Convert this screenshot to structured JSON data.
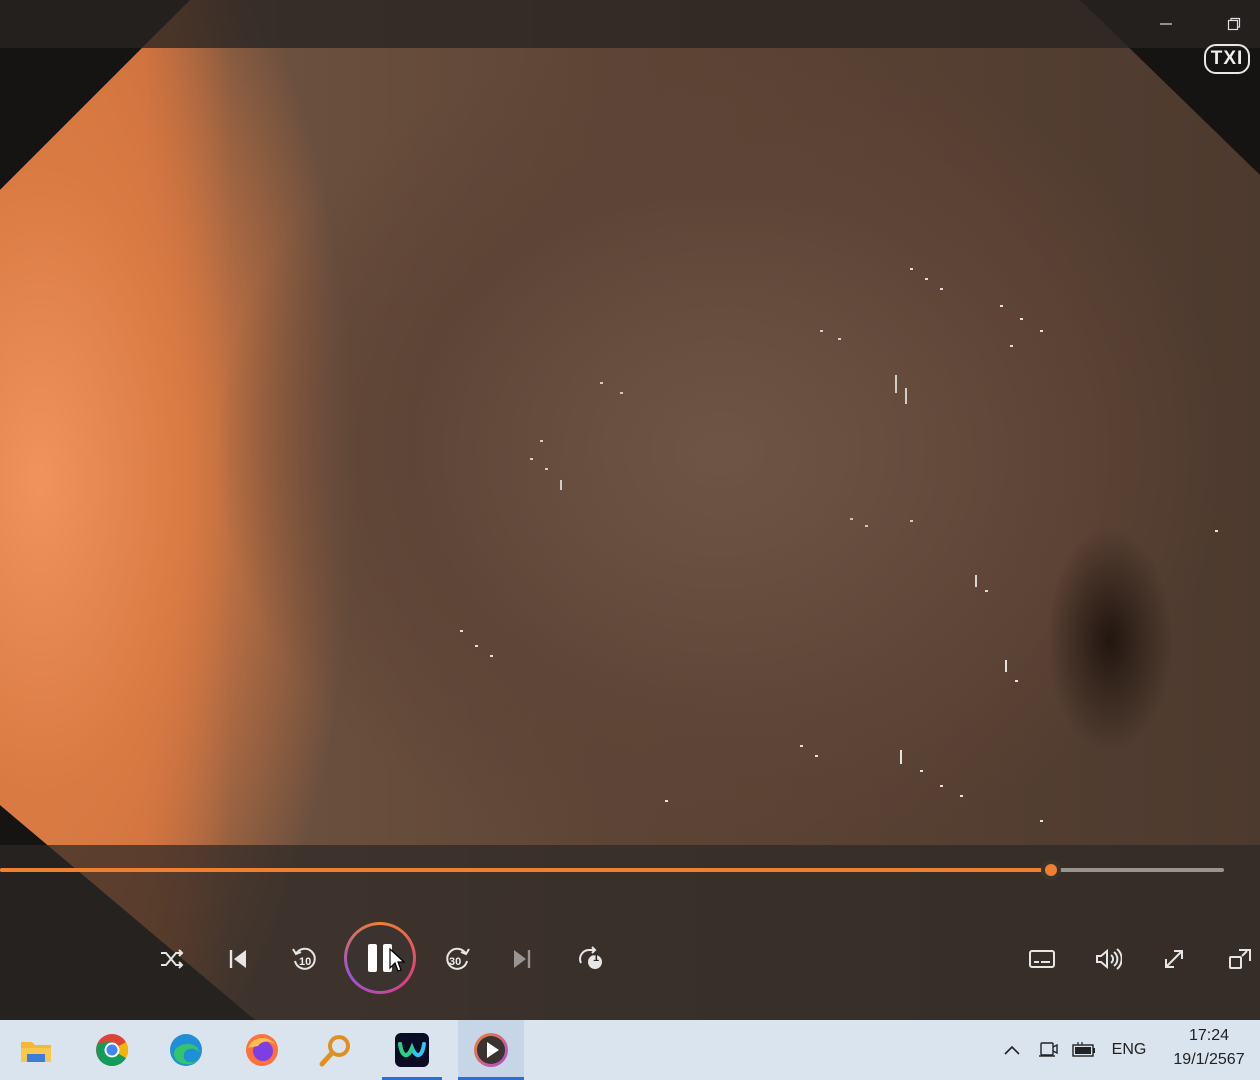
{
  "window": {
    "minimize_icon": "minimize-icon",
    "restore_icon": "restore-icon"
  },
  "overlay": {
    "badge": "TXI"
  },
  "player": {
    "progress": 0.859,
    "accent_color": "#f08030",
    "controls": {
      "shuffle": "shuffle-icon",
      "previous": "previous-icon",
      "skip_back_label": "10",
      "play_state": "playing",
      "skip_forward_label": "30",
      "next": "next-icon",
      "repeat_badge": "1",
      "captions": "captions-icon",
      "volume": "volume-icon",
      "fullscreen": "fullscreen-icon",
      "miniplayer": "miniplayer-icon"
    }
  },
  "taskbar": {
    "apps": [
      {
        "name": "file-explorer",
        "icon": "folder-icon"
      },
      {
        "name": "chrome",
        "icon": "chrome-icon"
      },
      {
        "name": "edge",
        "icon": "edge-icon"
      },
      {
        "name": "firefox",
        "icon": "firefox-icon"
      },
      {
        "name": "search-tool",
        "icon": "magnifier-icon"
      },
      {
        "name": "webex",
        "icon": "webex-icon",
        "open": true
      },
      {
        "name": "media-player",
        "icon": "media-player-icon",
        "open": true,
        "active": true
      }
    ],
    "tray": {
      "language": "ENG",
      "time": "17:24",
      "date": "19/1/2567"
    }
  }
}
